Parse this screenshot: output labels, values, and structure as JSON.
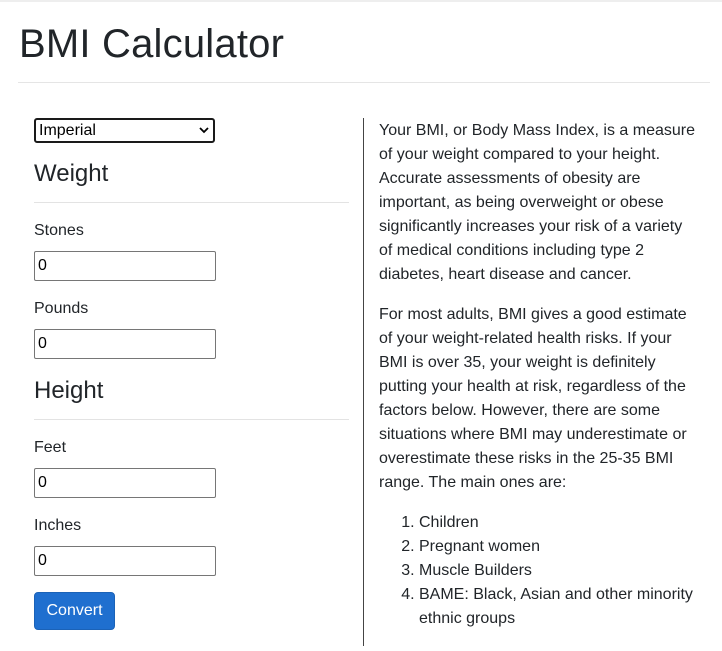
{
  "page": {
    "title": "BMI Calculator"
  },
  "form": {
    "unit_select": {
      "selected": "Imperial"
    },
    "weight": {
      "heading": "Weight",
      "stones_label": "Stones",
      "stones_value": "0",
      "pounds_label": "Pounds",
      "pounds_value": "0"
    },
    "height": {
      "heading": "Height",
      "feet_label": "Feet",
      "feet_value": "0",
      "inches_label": "Inches",
      "inches_value": "0"
    },
    "convert_label": "Convert"
  },
  "info": {
    "paragraphs": [
      "Your BMI, or Body Mass Index, is a measure of your weight compared to your height. Accurate assessments of obesity are important, as being overweight or obese significantly increases your risk of a variety of medical conditions including type 2 diabetes, heart disease and cancer.",
      "For most adults, BMI gives a good estimate of your weight-related health risks. If your BMI is over 35, your weight is definitely putting your health at risk, regardless of the factors below. However, there are some situations where BMI may underestimate or overestimate these risks in the 25-35 BMI range. The main ones are:"
    ],
    "list": [
      "Children",
      "Pregnant women",
      "Muscle Builders",
      "BAME: Black, Asian and other minority ethnic groups"
    ]
  },
  "colors": {
    "button_bg": "#1f6fcf",
    "text": "#212529"
  }
}
